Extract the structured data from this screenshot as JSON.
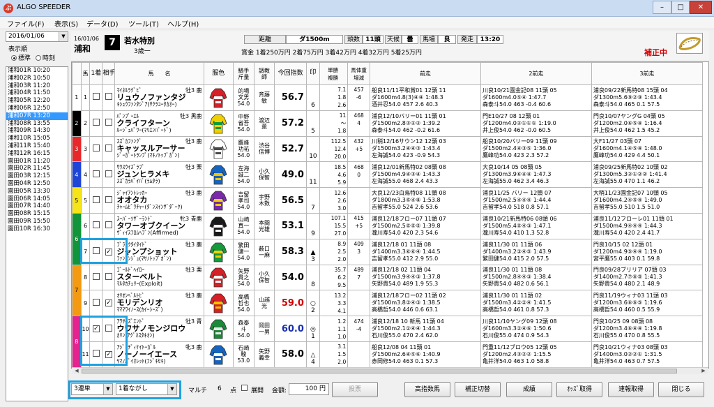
{
  "window": {
    "title": "ALGO SPEEDER",
    "app_icon_glyph": "ぷ",
    "minimize": "–",
    "maximize": "□",
    "close": "✕"
  },
  "menu": [
    "ファイル(F)",
    "表示(S)",
    "データ(D)",
    "ツール(T)",
    "ヘルプ(H)"
  ],
  "sidebar": {
    "date": "2016/01/06",
    "order_label": "表示順",
    "order_options": [
      "標準",
      "時刻"
    ],
    "races": [
      "浦和01R  10:20",
      "浦和02R  10:50",
      "浦和03R  11:20",
      "浦和04R  11:50",
      "浦和05R  12:20",
      "浦和06R  12:50",
      "浦和07R  13:20",
      "浦和08R  13:55",
      "浦和09R  14:30",
      "浦和10R  15:05",
      "浦和11R  15:40",
      "浦和12R  16:15",
      "園田01R  11:20",
      "園田02R  11:45",
      "園田03R  12:15",
      "園田04R  12:50",
      "園田05R  13:30",
      "園田06R  14:05",
      "園田07R  14:40",
      "園田08R  15:15",
      "園田09R  15:50",
      "園田10R  16:30"
    ],
    "selected_index": 6
  },
  "race": {
    "date": "16/01/06",
    "venue": "浦和",
    "number": "7",
    "name": "若水特別",
    "condition": "3歳一",
    "distance_label": "距離",
    "distance": "ダ1500m",
    "runners_label": "頭数",
    "runners": "11頭",
    "weather_label": "天候",
    "weather": "曇",
    "track_label": "馬場",
    "track": "良",
    "post_label": "発走",
    "post_time": "13:20",
    "prize": "賞金 1着250万円  2着75万円  3着42万円  4着32万円  5着25万円",
    "status": "補正中"
  },
  "table_headers": {
    "num": "馬",
    "first": "1着",
    "partner": "相手",
    "name": "馬　　名",
    "silk": "服色",
    "jockey": "騎手\n斤量",
    "trainer": "調教\n師",
    "index": "今回指数",
    "mark": "印",
    "odds": "単勝\n複勝",
    "weight": "馬体重\n増減",
    "prev1": "前走",
    "prev2": "2前走",
    "prev3": "3前走"
  },
  "horses": [
    {
      "frame": 1,
      "frame_color": "#ffffff",
      "num": "1",
      "first": false,
      "partner": false,
      "sire": "ﾏｲﾈﾙﾗｸﾞﾋﾞ",
      "sex": "牡3 鹿",
      "name": "リュウノファンタジ",
      "dam": "ｷｼｭｳﾌｧﾝﾀｼﾞｱ(ｻｸﾗﾕｰﾀｶｵｰ)",
      "silk_body": "#d61f26",
      "silk_pattern": "#ffffff",
      "jockey": "的場\n文男\n54.0",
      "trainer": "斉藤\n敏",
      "index": "56.7",
      "index_color": "#000000",
      "mark": "6",
      "odds": "7.1\n1.8\n2.6",
      "weight": "457\n-6\n\n",
      "p1": [
        "船良11/11平和賞01 12頭 11",
        "ダ1600m4.8(3)④④ 1:48.3",
        "酒井忍54.0 457 2.6 40.3"
      ],
      "p2": [
        "川良10/21園金記08 11頭 05",
        "ダ1600m4.0⑤④ 1:47.7",
        "森泰斗54.0 463 -0.4 60.6"
      ],
      "p3": [
        "浦良09/22新馬特08 15頭 04",
        "ダ1300m5.6⑨②⑨ 1:43.4",
        "森泰斗54.0 465 0.1 57.5"
      ]
    },
    {
      "frame": 2,
      "frame_color": "#000000",
      "num": "2",
      "first": false,
      "partner": false,
      "sire": "ﾊﾟﾝﾌﾟｰｴﾙ",
      "sex": "牡3 黒鹿",
      "name": "クライフターン",
      "dam": "ﾙｰｼﾞｭﾊﾟﾜｰ(ﾏﾘｴﾝﾊﾞｰﾄﾞ)",
      "silk_body": "#f0d000",
      "silk_pattern": "#0a9b3c",
      "jockey": "中野\n省吾\n54.0",
      "trainer": "渡辺\n薫",
      "index": "57.2",
      "index_color": "#000000",
      "mark": "5",
      "odds": "11\n～\n1.8",
      "weight": "468\n4\n\n",
      "p1": [
        "浦良12/10バリー01 11頭 01",
        "ダ1500m2.8③②② 1:39.2",
        "森泰斗54.0 462 -0.2 61.6"
      ],
      "p2": [
        "門E10/27 08 12頭 01",
        "ダ1200m4.0②①①① 1:19.0",
        "井上俊54.0 462 -0.0 60.5"
      ],
      "p3": [
        "門良10/07ヤングG 04頭 05",
        "ダ1200m2.0⑥⑤④ 1:16.4",
        "井上俊54.0 462 1.5 45.2"
      ]
    },
    {
      "frame": 3,
      "frame_color": "#e8272a",
      "num": "3",
      "first": false,
      "partner": false,
      "sire": "ｽｽﾞｶﾌｧﾝｸﾞ",
      "sex": "牡3 鹿",
      "name": "キャッスルアーサー",
      "dam": "ｼﾞｰｶﾞｰﾄﾗﾝﾌﾟ(ﾏｷﾉﾄｯﾌﾟｶﾞﾝ)",
      "silk_body": "#ffffff",
      "silk_pattern": "#4a4a4a",
      "jockey": "鷹峰\n功祐\n54.0",
      "trainer": "渋谷\n信博",
      "index": "52.7",
      "index_color": "#000000",
      "mark": "10",
      "odds": "112.5\n12.4\n20.0",
      "weight": "432\n+5\n\n",
      "p1": [
        "川稍12/16サウン12 12頭 03",
        "ダ1500m3.2④④③ 1:43.4",
        "左海誠54.0 423 -0.9 54.3"
      ],
      "p2": [
        "船良10/20バリー09 11頭 09",
        "ダ1500m2.4④③⑤ 1:36.0",
        "鷹峰功54.0 423 2.3 57.2"
      ],
      "p3": [
        "大F11/27 03頭 07",
        "ダ1600m4.1④⑤④ 1:48.0",
        "鷹峰功54.0 429 4.4 50.1"
      ]
    },
    {
      "frame": 4,
      "frame_color": "#1f45d6",
      "num": "4",
      "first": false,
      "partner": false,
      "sire": "ｻｳｽｳｲｽﾞﾗﾌﾞ",
      "sex": "牡3 栗",
      "name": "ジュンヒラメキ",
      "dam": "ｽｽﾞｶﾗﾊﾞｲﾊﾞ(ﾗﾑﾀﾗ)",
      "silk_body": "#1565c0",
      "silk_pattern": "#f2c200",
      "jockey": "左海\n誠二\n54.0",
      "trainer": "小久\n保智",
      "index": "49.0",
      "index_color": "#000000",
      "mark": "11",
      "odds": "18.5\n4.6\n5.9",
      "weight": "468\n0\n\n",
      "p1": [
        "浦良12/01新馬特02 08頭 08",
        "ダ1500m4.9④③④ 1:43.3",
        "左海誠55.0 468 2.4 43.3"
      ],
      "p2": [
        "大良10/14 05 08頭 05",
        "ダ1300m3.9⑥④④ 1:47.3",
        "左海誠55.0 462 3.4 46.3"
      ],
      "p3": [
        "浦良09/25新馬特02 10頭 02",
        "ダ1300m5.3②①②② 1:41.4",
        "左海誠55.0 470 1.1 46.2"
      ]
    },
    {
      "frame": 5,
      "frame_color": "#f6e318",
      "num": "5",
      "first": false,
      "partner": false,
      "sire": "ｼﾞｬｲｱﾝﾄﾚｯｶｰ",
      "sex": "牡3 鹿",
      "name": "オオタカ",
      "dam": "ﾁｬｰﾑﾋﾞﾜﾁｬｰ(ﾀﾞﾝｽｲﾝｻﾞﾀﾞｰｸ)",
      "silk_body": "#7a2aa8",
      "silk_pattern": "#f0d000",
      "jockey": "吉留\n孝司\n54.0",
      "trainer": "宇野\n木数",
      "index": "56.5",
      "index_color": "#000000",
      "mark": "7",
      "odds": "12.6\n2.6\n3.0",
      "weight": "\n\n\n",
      "p1": [
        "大良12/23白鳥特08 11頭 08",
        "ダ1800m3.3⑤④⑧ 1:53.8",
        "吉留孝55.0 524 2.6 53.6"
      ],
      "p2": [
        "浦良11/25 バリー 12頭 07",
        "ダ1500m2.5④④④ 1:44.4",
        "吉留孝54.0 518 0.8 57.1"
      ],
      "p3": [
        "大稍11/23園金記07 10頭 05",
        "ダ1600m4.2④⑤④ 1:49.0",
        "吉留孝55.0 510 1.5 51.0"
      ]
    },
    {
      "frame": 6,
      "frame_color": "#12953a",
      "num": "6",
      "first": false,
      "partner": false,
      "sire": "ｽｰﾊﾟｰｿｻﾞｰﾗﾝﾄﾞ",
      "sex": "牝3 青鹿",
      "name": "タワーオブクイーン",
      "dam": "ｳﾞｨｲｽﾌﾛﾑﾍﾌﾞﾝ(Affirmed)",
      "silk_body": "#1a1a1a",
      "silk_pattern": "#ffffff",
      "jockey": "山崎\n真一\n54.0",
      "trainer": "本間\n光雄",
      "index": "53.1",
      "index_color": "#000000",
      "mark": "9",
      "odds": "107.1\n15.5\n27.0",
      "weight": "415\n+5\n\n",
      "p1": [
        "浦良12/18フロー07 11頭 07",
        "ダ1500m2.5⑤⑤⑤ 1:39.8",
        "瀧川寿54.0 420 2.3 54.6"
      ],
      "p2": [
        "浦良10/21新馬特06 08頭 06",
        "ダ1500m5.4⑤④③ 1:47.1",
        "瀧川寿54.0 410 1.3 52.8"
      ],
      "p3": [
        "浦良11/12フローレ01 11頭 01",
        "ダ1500m4.9④④④ 1:44.3",
        "瀧川寿54.0 420 2.4 41.7"
      ]
    },
    {
      "frame": 6,
      "frame_color": "#12953a",
      "num": "7",
      "first": false,
      "partner": true,
      "sire": "ﾌﾞﾗｯｸﾀｲﾀｲﾄﾞ",
      "sex": "牡3 鹿",
      "name": "ジャンプショット",
      "dam": "ﾌｧﾝｱﾝｼﾞｭ(ﾏｻﾉﾄｯﾌﾟｶﾞﾝ)",
      "silk_body": "#159a3c",
      "silk_pattern": "#f2d000",
      "jockey": "繁田\n健一\n54.0",
      "trainer": "薮口\n一麻",
      "index": "58.3",
      "index_color": "#000000",
      "mark": "▲\n3",
      "odds": "8.9\n2.5\n2.0",
      "weight": "409\n3\n\n",
      "p1": [
        "浦良12/18 01 11頭 08",
        "ダ1400m3.3⑥⑥④ 1:44.5",
        "吉留孝55.0 412 2.9 55.0"
      ],
      "p2": [
        "浦良11/30 01 11頭 06",
        "ダ1400m3.2③④⑤ 1:43.9",
        "繁田健54.0 415 2.0 57.5"
      ],
      "p3": [
        "門良10/15 02 12頭 01",
        "ダ1200m4.9⑤④④ 1:19.0",
        "宮平鷹55.0 403 0.1 59.8"
      ]
    },
    {
      "frame": 7,
      "frame_color": "#f39a12",
      "num": "8",
      "first": false,
      "partner": false,
      "sire": "ｺﾞｰﾙﾄﾞﾍｲﾛｰ",
      "sex": "牡3 栗",
      "name": "スターベルト",
      "dam": "ﾏﾙﾀｶﾁｪﾘｰ(Exploit)",
      "silk_body": "#d61f26",
      "silk_pattern": "#ffffff",
      "jockey": "矢野\n貴之\n54.0",
      "trainer": "小久\n保智",
      "index": "54.0",
      "index_color": "#000000",
      "mark": "8",
      "odds": "35.7\n6.2\n9.5",
      "weight": "489\n7\n\n",
      "p1": [
        "浦良12/18 02 11頭 04",
        "ダ1500m3.9④④③ 1:37.8",
        "矢野貴54.0 489 1.9 55.3"
      ],
      "p2": [
        "浦良11/30 01 11頭 08",
        "ダ1500m2.8④④③ 1:38.4",
        "矢野貴54.0 482 0.6 56.1"
      ],
      "p3": [
        "門良09/28ブリリア 07頭 03",
        "ダ1400m2.7⑦⑥⑤ 1:41.3",
        "矢野貴54.0 480 2.1 48.9"
      ]
    },
    {
      "frame": 7,
      "frame_color": "#f39a12",
      "num": "9",
      "first": false,
      "partner": true,
      "sire": "ｵﾘｵﾝﾍﾞﾙﾄﾋﾞ",
      "sex": "牡3 鹿",
      "name": "モリデンリオ",
      "dam": "ﾏﾏﾏﾜｲﾉｰｽ(ｶｲｰｼｰｽﾞ)",
      "silk_body": "#d61f26",
      "silk_pattern": "#f2c200",
      "jockey": "高橋\n哲也\n54.0",
      "trainer": "山越\n光",
      "index": "59.0",
      "index_color": "#d40000",
      "mark": "○\n2",
      "odds": "13.2\n3.3\n4.1",
      "weight": "\n\n\n",
      "p1": [
        "浦良12/18フロー02 11頭 02",
        "ダ1500m3.8③④③ 1:38.5",
        "高橋哲54.0 446 0.6 63.1"
      ],
      "p2": [
        "浦良11/30 01 11頭 02",
        "ダ1500m3.4②②④ 1:41.5",
        "高橋哲54.0 461 0.8 57.3"
      ],
      "p3": [
        "門良11/19ウィナ03 11頭 03",
        "ダ1200m3.6⑥⑥⑤ 1:19.6",
        "高橋哲54.0 460 0.5 55.9"
      ]
    },
    {
      "frame": 8,
      "frame_color": "#e5228e",
      "num": "10",
      "first": true,
      "partner": false,
      "sire": "ｱﾜｻｲｽﾞｴﾝﾄﾞ",
      "sex": "牡3 青",
      "name": "ウワサノモンジロウ",
      "dam": "ｶﾘﾝ(ｱｸﾞﾈｽﾀｷｵﾝ)",
      "silk_body": "#1a8a3a",
      "silk_pattern": "#e8e8e8",
      "jockey": "森泰\n斗\n54.0",
      "trainer": "岡田\n一男",
      "index": "60.0",
      "index_color": "#1a30b0",
      "mark": "◎\n1",
      "odds": "1.2\n1.1\n1.0",
      "weight": "474\n-4\n\n",
      "p1": [
        "浦良12/18 10 新馬 11頭 04",
        "ダ1500m2.1②④④ 1:44.3",
        "石川俊55.0 470 2.4 62.0"
      ],
      "p2": [
        "川良11/10ヤング09 12頭 08",
        "ダ1600m3.3②④⑥ 1:50.6",
        "石川俊55.0 474 0.9 54.3"
      ],
      "p3": [
        "門良10/25 09 08頭 08",
        "ダ1200m3.4⑥④④ 1:19.8",
        "石川俊55.0 470 0.8 55.5"
      ]
    },
    {
      "frame": 8,
      "frame_color": "#e5228e",
      "num": "11",
      "first": false,
      "partner": true,
      "sire": "ｱｼﾞｭﾃﾞｨｹｲﾄｰｶﾞﾙ",
      "sex": "牝3 鹿",
      "name": "ノーノーイエース",
      "dam": "ﾔﾏﾉﾊﾞｲｵﾚｯﾄ(ﾌｼﾞｷｾｷ)",
      "silk_body": "#1565c0",
      "silk_pattern": "#ffffff",
      "jockey": "石崎\n駿\n53.0",
      "trainer": "矢野\n義幸",
      "index": "58.0",
      "index_color": "#000000",
      "mark": "△\n4",
      "odds": "3.1\n1.5\n2.0",
      "weight": "\n\n\n",
      "p1": [
        "船良12/08 04 11頭 01",
        "ダ1500m2.6④⑤⑥ 1:40.9",
        "赤岡修54.0 463 0.1 57.3"
      ],
      "p2": [
        "門重11/12ブロウ05 12頭 05",
        "ダ1200m2.4③②② 1:15.5",
        "亀井洋54.0 463 1.0 58.8"
      ],
      "p3": [
        "門良10/21ウィナ03 08頭 03",
        "ダ1400m3.0②②① 1:31.5",
        "亀井洋54.0 463 0.7 57.5"
      ]
    }
  ],
  "bottom": {
    "bet_type": "3連単",
    "bet_method": "1着ながし",
    "multi_label": "マルチ",
    "points": "6",
    "points_unit": "点",
    "expand_label": "展開",
    "amount_label": "金額:",
    "amount": "100",
    "amount_unit": "円",
    "vote_button": "投票",
    "buttons": [
      "高指数馬",
      "補正切替",
      "成績",
      "ｵｯｽﾞ取得",
      "速報取得",
      "閉じる"
    ]
  }
}
